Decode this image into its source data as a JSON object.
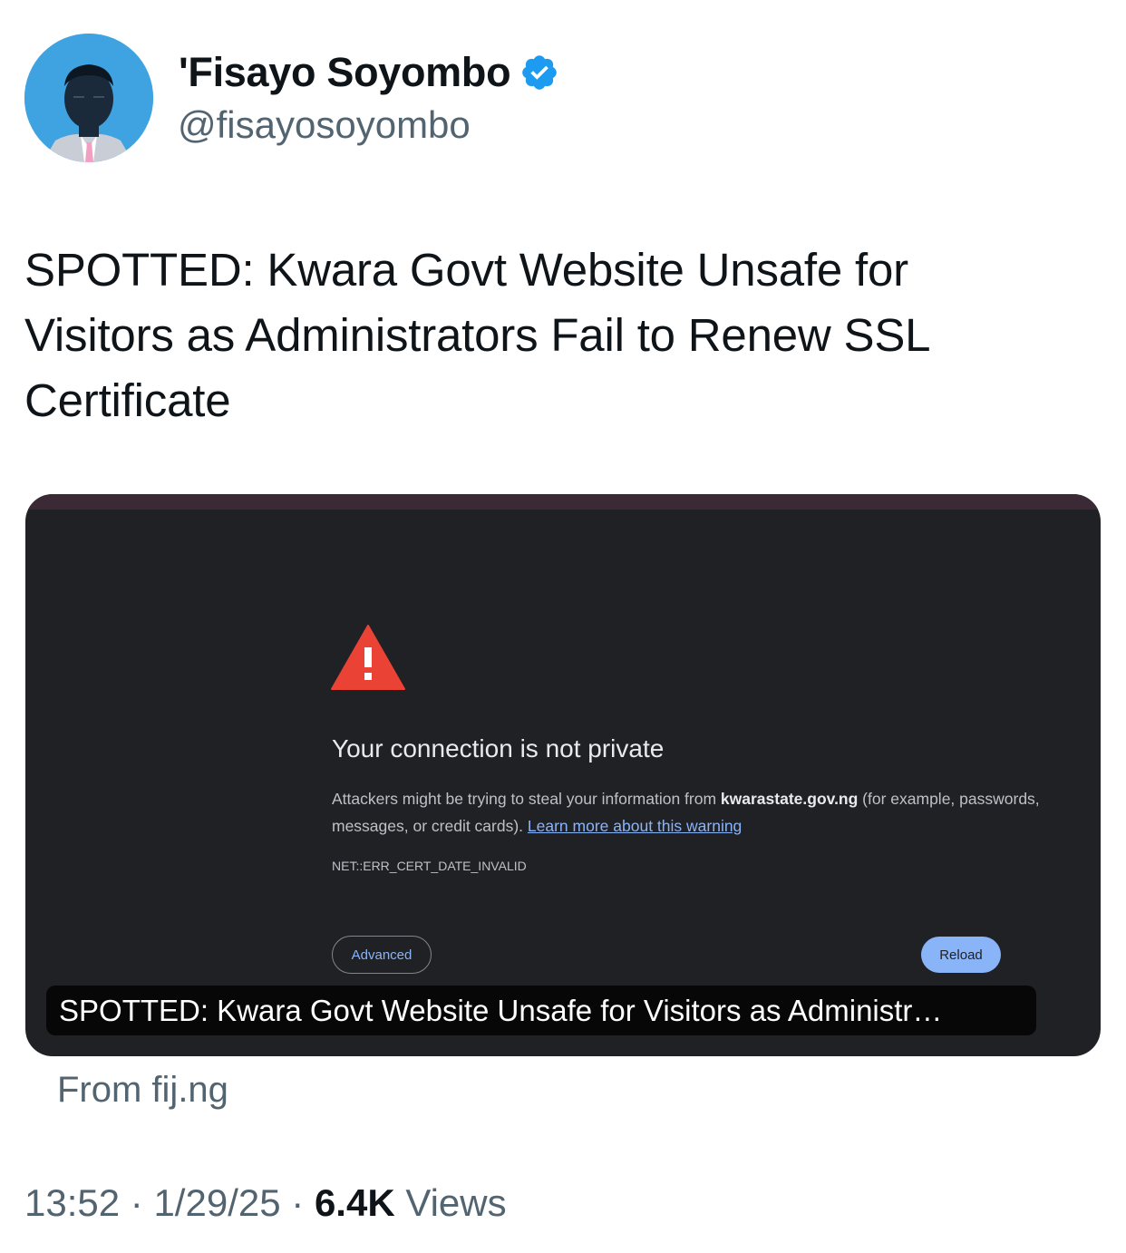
{
  "author": {
    "display_name": "'Fisayo Soyombo",
    "handle": "@fisayosoyombo",
    "verified": true,
    "avatar_icon": "profile-illustration",
    "verified_color": "#1d9bf0"
  },
  "tweet": {
    "text": "SPOTTED: Kwara Govt Website Unsafe for Visitors as Administrators Fail to Renew SSL Certificate"
  },
  "card": {
    "screenshot": {
      "warning_icon": "warning-triangle-icon",
      "heading": "Your connection is not private",
      "body_prefix": "Attackers might be trying to steal your information from ",
      "domain": "kwarastate.gov.ng",
      "body_suffix": " (for example, passwords, messages, or credit cards). ",
      "learn_more": "Learn more about this warning",
      "error_code": "NET::ERR_CERT_DATE_INVALID",
      "advanced_label": "Advanced",
      "reload_label": "Reload",
      "accent_color": "#8ab4f8",
      "background_color": "#202124"
    },
    "caption": "SPOTTED: Kwara Govt Website Unsafe for Visitors as Administr…",
    "source": "From fij.ng"
  },
  "meta": {
    "time": "13:52",
    "separator": "·",
    "date": "1/29/25",
    "views_count": "6.4K",
    "views_label": "Views"
  }
}
